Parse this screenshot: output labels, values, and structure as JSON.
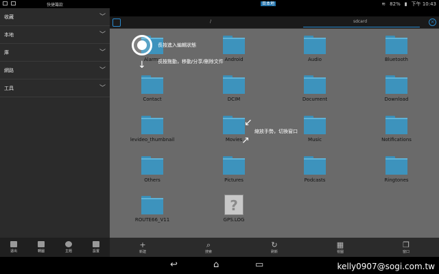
{
  "status_bar": {
    "title": "快捷籌款",
    "mid_tag": "目本地",
    "mid_text": "本地",
    "battery": "82%",
    "time": "下午 10:43"
  },
  "sidebar": {
    "items": [
      {
        "label": "收藏"
      },
      {
        "label": "本地"
      },
      {
        "label": "庫"
      },
      {
        "label": "網路"
      },
      {
        "label": "工具"
      }
    ],
    "tools": [
      {
        "label": "退出",
        "icon": "exit-icon"
      },
      {
        "label": "轉圖",
        "icon": "gift-icon"
      },
      {
        "label": "主題",
        "icon": "theme-icon"
      },
      {
        "label": "設置",
        "icon": "settings-icon"
      }
    ]
  },
  "pathbar": {
    "seg1": "/",
    "seg2": "sdcard"
  },
  "files": [
    {
      "name": "Alarms",
      "type": "folder"
    },
    {
      "name": "Android",
      "type": "folder"
    },
    {
      "name": "Audio",
      "type": "folder"
    },
    {
      "name": "Bluetooth",
      "type": "folder"
    },
    {
      "name": "Contact",
      "type": "folder"
    },
    {
      "name": "DCIM",
      "type": "folder"
    },
    {
      "name": "Document",
      "type": "folder"
    },
    {
      "name": "Download",
      "type": "folder"
    },
    {
      "name": "levideo_thumbnail",
      "type": "folder"
    },
    {
      "name": "Movies",
      "type": "folder"
    },
    {
      "name": "Music",
      "type": "folder"
    },
    {
      "name": "Notifications",
      "type": "folder"
    },
    {
      "name": "Others",
      "type": "folder"
    },
    {
      "name": "Pictures",
      "type": "folder"
    },
    {
      "name": "Podcasts",
      "type": "folder"
    },
    {
      "name": "Ringtones",
      "type": "folder"
    },
    {
      "name": "ROUTE66_V11",
      "type": "folder"
    },
    {
      "name": "GPS.LOG",
      "type": "file"
    }
  ],
  "hints": {
    "long_press": "長按進入編輯狀態",
    "drag": "長按拖動，移動/分享/刪除文件",
    "pinch": "縮放手勢，切換窗口"
  },
  "actions": [
    {
      "label": "新建",
      "icon": "plus-icon"
    },
    {
      "label": "搜索",
      "icon": "search-icon"
    },
    {
      "label": "刷新",
      "icon": "refresh-icon"
    },
    {
      "label": "視圖",
      "icon": "grid-icon"
    },
    {
      "label": "窗口",
      "icon": "window-icon"
    }
  ],
  "watermark": "kelly0907@sogi.com.tw",
  "colors": {
    "accent": "#2a8bcf",
    "folder": "#3d93bd",
    "grid_bg": "#6a6a6a",
    "sidebar_bg": "#2b2b2b"
  }
}
